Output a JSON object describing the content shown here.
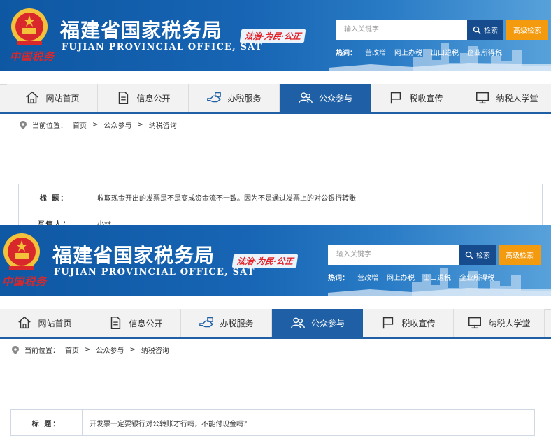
{
  "header": {
    "title": "福建省国家税务局",
    "title_en": "FUJIAN PROVINCIAL OFFICE, SAT",
    "slogan": "法治·为民·公正",
    "china_tax_logo_text": "中国税务",
    "search_placeholder": "输入关键字",
    "search_button": "检索",
    "advanced_search_button": "高级检索",
    "hotwords_label": "热词：",
    "hotwords": [
      "营改增",
      "网上办税",
      "出口退税",
      "企业所得税"
    ]
  },
  "nav": {
    "items": [
      {
        "label": "网站首页",
        "icon": "home-icon"
      },
      {
        "label": "信息公开",
        "icon": "document-icon"
      },
      {
        "label": "办税服务",
        "icon": "handshake-icon"
      },
      {
        "label": "公众参与",
        "icon": "people-icon"
      },
      {
        "label": "税收宣传",
        "icon": "flag-icon"
      },
      {
        "label": "纳税人学堂",
        "icon": "monitor-icon"
      }
    ],
    "active_index": 3
  },
  "breadcrumb": {
    "prefix": "当前位置：",
    "items": [
      "首页",
      "公众参与",
      "纳税咨询"
    ],
    "separator": ">"
  },
  "panels": [
    {
      "title_label": "标 题：",
      "title_value": "收取现金开出的发票是不是变成资金流不一致。因为不是通过发票上的对公银行转账",
      "writer_label": "写信人：",
      "writer_value": "小**"
    },
    {
      "title_label": "标 题：",
      "title_value": "开发票一定要银行对公转账才行吗，不能付现金吗？"
    }
  ],
  "colors": {
    "header_blue": "#0e57a3",
    "nav_active": "#1f5fa6",
    "advanced_orange": "#f39a0e",
    "search_dark": "#164c8e",
    "logo_red": "#d9282b"
  }
}
